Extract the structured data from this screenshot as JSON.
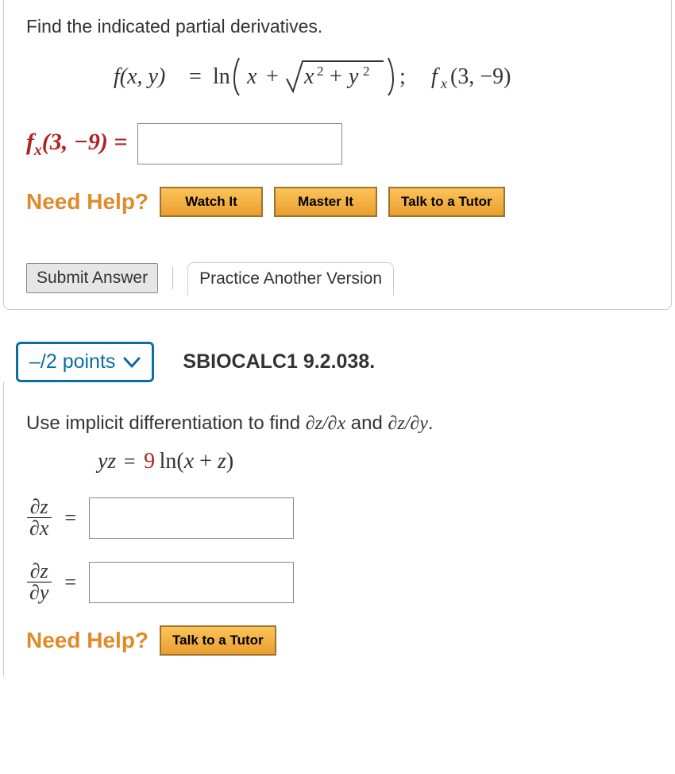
{
  "q1": {
    "prompt": "Find the indicated partial derivatives.",
    "equation_text": "f(x, y) = ln( x + √(x² + y²) );   f_x(3, -9)",
    "answer_label_html": "f_x(3, −9) =",
    "help_label": "Need Help?",
    "buttons": {
      "watch": "Watch It",
      "master": "Master It",
      "tutor": "Talk to a Tutor"
    },
    "footer": {
      "submit": "Submit Answer",
      "practice": "Practice Another Version"
    }
  },
  "q2": {
    "points": "–/2 points",
    "cite": "SBIOCALC1 9.2.038.",
    "prompt": "Use implicit differentiation to find ∂z/∂x and ∂z/∂y.",
    "equation_parts": {
      "lhs": "yz",
      "eq": " = ",
      "coef": "9",
      "rhs": " ln(x + z)"
    },
    "rows": {
      "dzdx": {
        "num": "∂z",
        "den": "∂x"
      },
      "dzdy": {
        "num": "∂z",
        "den": "∂y"
      }
    },
    "help_label": "Need Help?",
    "tutor": "Talk to a Tutor"
  }
}
